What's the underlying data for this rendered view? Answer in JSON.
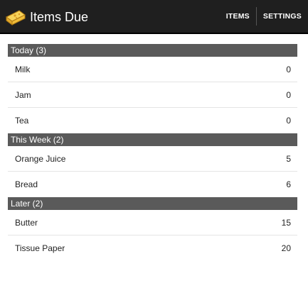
{
  "app": {
    "title": "Items Due",
    "icon": "cheese-icon"
  },
  "actions": [
    {
      "label": "ITEMS"
    },
    {
      "label": "SETTINGS"
    }
  ],
  "sections": [
    {
      "header": "Today (3)",
      "items": [
        {
          "name": "Milk",
          "count": "0"
        },
        {
          "name": "Jam",
          "count": "0"
        },
        {
          "name": "Tea",
          "count": "0"
        }
      ]
    },
    {
      "header": "This Week (2)",
      "items": [
        {
          "name": "Orange Juice",
          "count": "5"
        },
        {
          "name": "Bread",
          "count": "6"
        }
      ]
    },
    {
      "header": "Later (2)",
      "items": [
        {
          "name": "Butter",
          "count": "15"
        },
        {
          "name": "Tissue Paper",
          "count": "20"
        }
      ]
    }
  ],
  "colors": {
    "action_bar": "#1f1f1f",
    "section_header": "#5a5a5a",
    "divider": "#e4e4e4"
  }
}
